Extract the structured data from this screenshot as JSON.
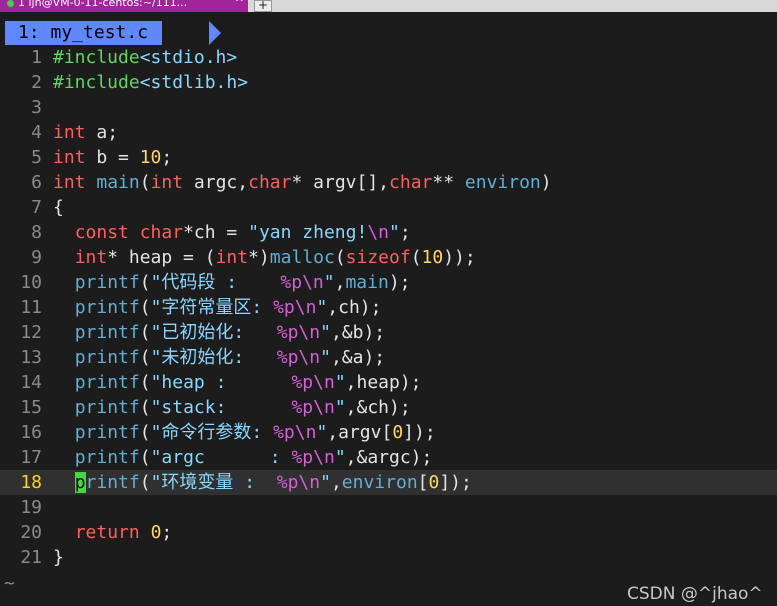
{
  "window_tab": {
    "title": "1 ljh@VM-0-11-centos:~/111...",
    "close": "^",
    "add": "+"
  },
  "buffer_tab": {
    "label": "1: my_test.c"
  },
  "code_lines": [
    {
      "num": "1",
      "text": "#include<stdio.h>"
    },
    {
      "num": "2",
      "text": "#include<stdlib.h>"
    },
    {
      "num": "3",
      "text": ""
    },
    {
      "num": "4",
      "text": "int a;"
    },
    {
      "num": "5",
      "text": "int b = 10;"
    },
    {
      "num": "6",
      "text": "int main(int argc,char* argv[],char** environ)"
    },
    {
      "num": "7",
      "text": "{"
    },
    {
      "num": "8",
      "text": "  const char*ch = \"yan zheng!\\n\";"
    },
    {
      "num": "9",
      "text": "  int* heap = (int*)malloc(sizeof(10));"
    },
    {
      "num": "10",
      "text": "  printf(\"代码段 :    %p\\n\",main);"
    },
    {
      "num": "11",
      "text": "  printf(\"字符常量区: %p\\n\",ch);"
    },
    {
      "num": "12",
      "text": "  printf(\"已初始化:   %p\\n\",&b);"
    },
    {
      "num": "13",
      "text": "  printf(\"未初始化:   %p\\n\",&a);"
    },
    {
      "num": "14",
      "text": "  printf(\"heap :      %p\\n\",heap);"
    },
    {
      "num": "15",
      "text": "  printf(\"stack:      %p\\n\",&ch);"
    },
    {
      "num": "16",
      "text": "  printf(\"命令行参数: %p\\n\",argv[0]);"
    },
    {
      "num": "17",
      "text": "  printf(\"argc      : %p\\n\",&argc);"
    },
    {
      "num": "18",
      "text": "  printf(\"环境变量 :  %p\\n\",environ[0]);"
    },
    {
      "num": "19",
      "text": ""
    },
    {
      "num": "20",
      "text": "  return 0;"
    },
    {
      "num": "21",
      "text": "}"
    }
  ],
  "current_line": "18",
  "tilde": "~",
  "watermark": "CSDN @^jhao^",
  "colors": {
    "background": "#1c1c1c",
    "keyword": "#ff5f5f",
    "function": "#5fafd7",
    "string": "#87d7ff",
    "format_spec": "#d75fd7",
    "include": "#5fd75f",
    "number": "#ffd75f",
    "line_number": "#8a8a8a",
    "current_line_number": "#ffd700",
    "buffer_tab": "#5f87ff",
    "window_tab": "#a2249b",
    "cursor": "#3fdc3f"
  }
}
